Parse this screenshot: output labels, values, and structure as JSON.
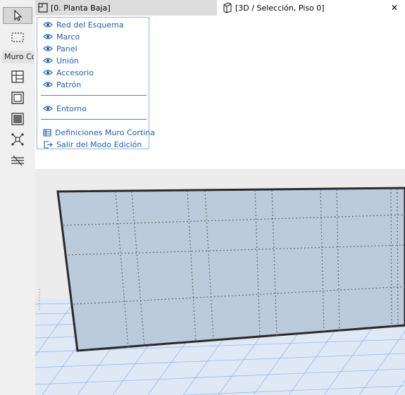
{
  "toolbox": {
    "section_label": "Muro Co",
    "tools": [
      {
        "icon": "arrow-pointer-icon"
      },
      {
        "icon": "marquee-select-icon"
      },
      {
        "icon": "grid-scheme-icon"
      },
      {
        "icon": "frame-icon"
      },
      {
        "icon": "panel-icon"
      },
      {
        "icon": "junction-icon"
      },
      {
        "icon": "accessory-icon"
      }
    ]
  },
  "tabs": {
    "plan_label": "[0. Planta Baja]",
    "view3d_label": "[3D / Selección, Piso 0]",
    "close_label": "✕"
  },
  "menu": {
    "items": [
      {
        "label": "Red del Esquema",
        "icon": "eye-icon"
      },
      {
        "label": "Marco",
        "icon": "eye-icon"
      },
      {
        "label": "Panel",
        "icon": "eye-icon"
      },
      {
        "label": "Unión",
        "icon": "eye-icon"
      },
      {
        "label": "Accesorio",
        "icon": "eye-icon"
      },
      {
        "label": "Patrón",
        "icon": "eye-icon"
      }
    ],
    "environment": {
      "label": "Entorno",
      "icon": "eye-icon"
    },
    "actions": [
      {
        "label": "Definiciones Muro Cortina",
        "icon": "curtain-wall-settings-icon"
      },
      {
        "label": "Salir del Modo Edición",
        "icon": "exit-icon"
      }
    ]
  },
  "colors": {
    "menu_text": "#1e5fb0",
    "panel_fill": "#bccbdb",
    "ground": "#dfe9f5",
    "grid_line": "#9ab7e6"
  }
}
